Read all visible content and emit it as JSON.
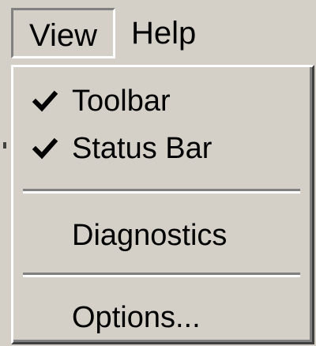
{
  "menubar": {
    "items": [
      {
        "label": "View",
        "state": "open"
      },
      {
        "label": "Help"
      }
    ]
  },
  "view_menu": {
    "items": [
      {
        "label": "Toolbar",
        "checked": true,
        "icon": "checkmark-icon"
      },
      {
        "label": "Status Bar",
        "checked": true,
        "icon": "checkmark-icon"
      },
      {
        "label": "Diagnostics",
        "checked": false
      },
      {
        "label": "Options...",
        "checked": false
      }
    ]
  },
  "colors": {
    "face": "#d4d0c8",
    "shadow": "#808080",
    "dark_shadow": "#404040",
    "highlight": "#ffffff",
    "text": "#000000"
  }
}
